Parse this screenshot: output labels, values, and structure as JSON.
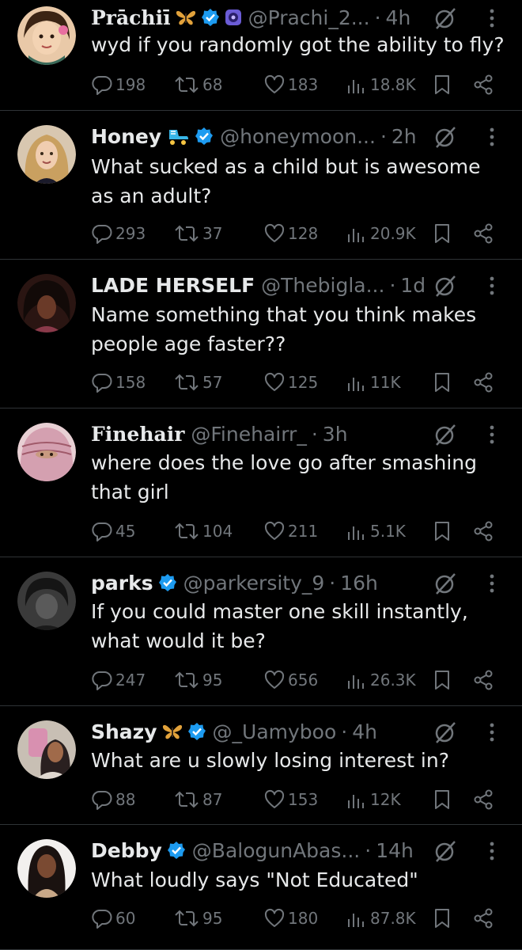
{
  "tweets": [
    {
      "name": "Prāchiī",
      "emoji": "butterfly",
      "verified": true,
      "extra_badge": "purple-badge",
      "handle": "@Prachi_2...",
      "time": "4h",
      "text": "wyd if you randomly got the ability to fly?",
      "replies": "198",
      "retweets": "68",
      "likes": "183",
      "views": "18.8K",
      "avatar_color": "#7a4a2a"
    },
    {
      "name": "Honey",
      "emoji": "roller-skate",
      "verified": true,
      "handle": "@honeymoon...",
      "time": "2h",
      "text": "What sucked as a child but is awesome as an adult?",
      "replies": "293",
      "retweets": "37",
      "likes": "128",
      "views": "20.9K",
      "avatar_color": "#c8a47a"
    },
    {
      "name": "LADE HERSELF",
      "verified": false,
      "handle": "@Thebigla...",
      "time": "1d",
      "text": "Name something that you think makes people age faster??",
      "replies": "158",
      "retweets": "57",
      "likes": "125",
      "views": "11K",
      "avatar_color": "#3a1e1a"
    },
    {
      "name": "Finehair",
      "verified": false,
      "handle": "@Finehairr_",
      "time": "3h",
      "text": "where does the love go after smashing that girl",
      "replies": "45",
      "retweets": "104",
      "likes": "211",
      "views": "5.1K",
      "avatar_color": "#c98a9a"
    },
    {
      "name": "parks",
      "verified": true,
      "handle": "@parkersity_9",
      "time": "16h",
      "text": "If you could master one skill instantly, what would it be?",
      "replies": "247",
      "retweets": "95",
      "likes": "656",
      "views": "26.3K",
      "avatar_color": "#2a2a2a"
    },
    {
      "name": "Shazy",
      "emoji": "butterfly",
      "verified": true,
      "handle": "@_Uamyboo",
      "time": "4h",
      "text": "What are u slowly losing interest in?",
      "replies": "88",
      "retweets": "87",
      "likes": "153",
      "views": "12K",
      "avatar_color": "#b8a89a"
    },
    {
      "name": "Debby",
      "verified": true,
      "handle": "@BalogunAbas...",
      "time": "14h",
      "text": "What loudly says \"Not Educated\"",
      "replies": "60",
      "retweets": "95",
      "likes": "180",
      "views": "87.8K",
      "avatar_color": "#5a3a2a"
    }
  ],
  "colors": {
    "accent": "#1d9bf0",
    "muted": "#71767b",
    "divider": "#2f3336"
  }
}
